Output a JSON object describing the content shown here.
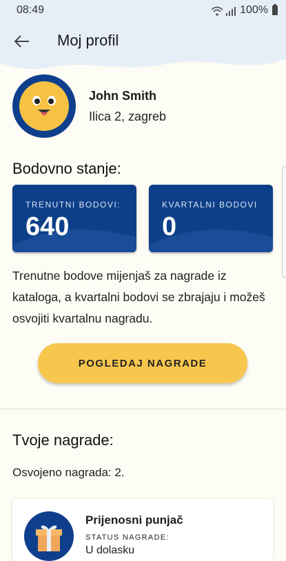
{
  "status_bar": {
    "time": "08:49",
    "battery": "100%"
  },
  "header": {
    "title": "Moj profil"
  },
  "profile": {
    "name": "John Smith",
    "address": "Ilica 2, zagreb"
  },
  "points": {
    "section_title": "Bodovno stanje:",
    "current_label": "TRENUTNI BODOVI:",
    "current_value": "640",
    "quarterly_label": "KVARTALNI BODOVI",
    "quarterly_value": "0",
    "description": "Trenutne bodove mijenjaš za nagrade iz kataloga, a kvartalni bodovi se zbrajaju i možeš osvojiti kvartalnu nagradu.",
    "button_label": "POGLEDAJ NAGRADE"
  },
  "rewards": {
    "section_title": "Tvoje nagrade:",
    "won_count": "Osvojeno nagrada: 2.",
    "items": [
      {
        "name": "Prijenosni punjač",
        "status_label": "STATUS NAGRADE:",
        "status": "U dolasku"
      }
    ]
  },
  "colors": {
    "primary": "#0d3f88",
    "accent": "#f7c64d",
    "background": "#fdfcf5",
    "header": "#e6eef8"
  }
}
